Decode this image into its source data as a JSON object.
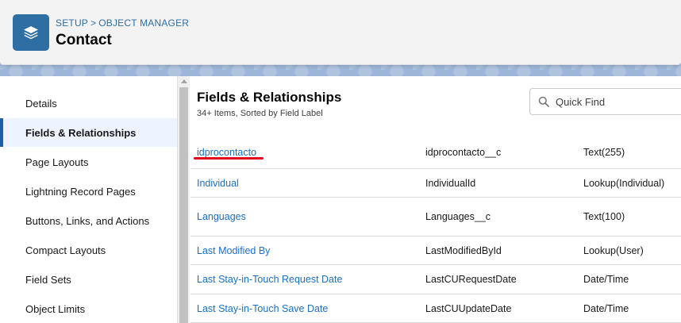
{
  "header": {
    "breadcrumb": [
      "SETUP",
      "OBJECT MANAGER"
    ],
    "breadcrumb_sep": ">",
    "title": "Contact",
    "icon": "layers-icon"
  },
  "sidebar": {
    "items": [
      {
        "label": "Details",
        "active": false
      },
      {
        "label": "Fields & Relationships",
        "active": true
      },
      {
        "label": "Page Layouts",
        "active": false
      },
      {
        "label": "Lightning Record Pages",
        "active": false
      },
      {
        "label": "Buttons, Links, and Actions",
        "active": false
      },
      {
        "label": "Compact Layouts",
        "active": false
      },
      {
        "label": "Field Sets",
        "active": false
      },
      {
        "label": "Object Limits",
        "active": false
      }
    ]
  },
  "main": {
    "title": "Fields & Relationships",
    "subtitle": "34+ Items, Sorted by Field Label",
    "search": {
      "placeholder": "Quick Find",
      "value": ""
    },
    "rows": [
      {
        "label": "idprocontacto",
        "api": "idprocontacto__c",
        "type": "Text(255)"
      },
      {
        "label": "Individual",
        "api": "IndividualId",
        "type": "Lookup(Individual)"
      },
      {
        "label": "Languages",
        "api": "Languages__c",
        "type": "Text(100)"
      },
      {
        "label": "Last Modified By",
        "api": "LastModifiedById",
        "type": "Lookup(User)"
      },
      {
        "label": "Last Stay-in-Touch Request Date",
        "api": "LastCURequestDate",
        "type": "Date/Time"
      },
      {
        "label": "Last Stay-in-Touch Save Date",
        "api": "LastCUUpdateDate",
        "type": "Date/Time"
      }
    ]
  },
  "colors": {
    "accent": "#1b6fc4",
    "icon_bg": "#2e6ea3",
    "highlight_mark": "#e3001b"
  }
}
